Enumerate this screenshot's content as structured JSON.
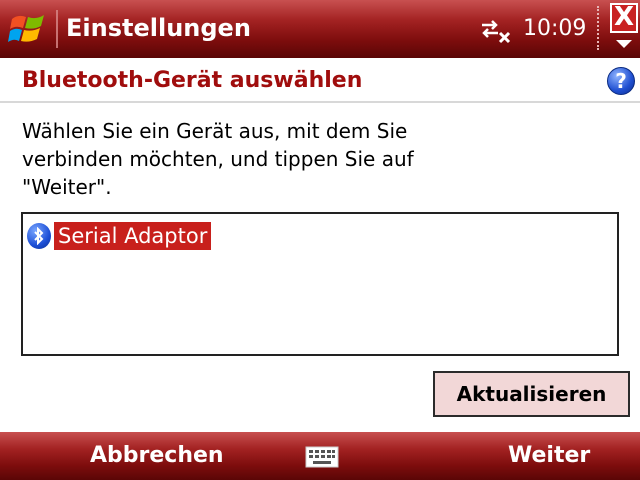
{
  "titlebar": {
    "title": "Einstellungen",
    "time": "10:09",
    "start_icon": "windows-flag-icon",
    "connectivity_icon": "connectivity-icon",
    "close_icon": "close-icon"
  },
  "header": {
    "title": "Bluetooth-Gerät auswählen",
    "help_icon": "help-icon",
    "help_label": "?"
  },
  "instructions": {
    "lines": [
      "Wählen Sie ein Gerät aus, mit dem Sie",
      "verbinden möchten, und tippen Sie auf",
      "\"Weiter\"."
    ]
  },
  "device_list": {
    "items": [
      {
        "label": "Serial Adaptor",
        "icon": "bluetooth-icon",
        "selected": true
      }
    ]
  },
  "buttons": {
    "refresh_label": "Aktualisieren",
    "close_label": "X"
  },
  "softkeys": {
    "left": "Abbrechen",
    "right": "Weiter",
    "center_icon": "keyboard-icon"
  },
  "colors": {
    "bar_red": "#8b1010",
    "title_red": "#a00d0d",
    "selection_red": "#c8201c",
    "button_bg": "#f2d7d7"
  }
}
